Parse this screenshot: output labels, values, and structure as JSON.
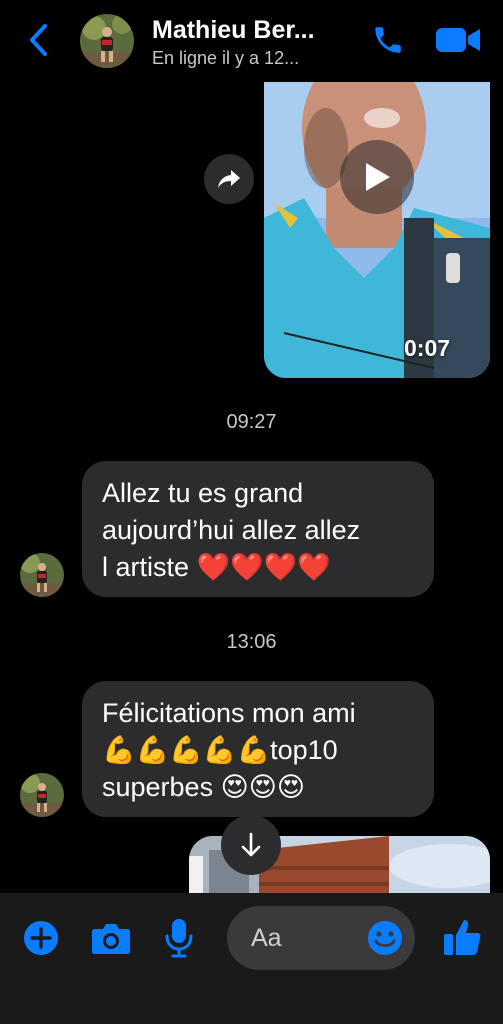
{
  "header": {
    "contact_name": "Mathieu Ber...",
    "status": "En ligne il y a 12...",
    "back_icon": "chevron-left-icon",
    "call_icon": "phone-icon",
    "video_call_icon": "video-camera-icon"
  },
  "video_message": {
    "duration": "0:07",
    "forward_icon": "share-arrow-icon",
    "play_icon": "play-icon"
  },
  "messages": [
    {
      "timestamp": "09:27",
      "lines": [
        "Allez tu es grand",
        "aujourd’hui allez allez",
        "l artiste ❤️❤️❤️❤️"
      ]
    },
    {
      "timestamp": "13:06",
      "lines": [
        "Félicitations mon ami",
        "💪💪💪💪💪top10",
        "superbes 😍😍😍"
      ]
    }
  ],
  "scroll_down_icon": "arrow-down-icon",
  "composer": {
    "placeholder": "Aa",
    "plus_icon": "plus-circle-icon",
    "camera_icon": "camera-icon",
    "mic_icon": "microphone-icon",
    "emoji_icon": "smiley-icon",
    "like_icon": "thumbs-up-icon"
  },
  "colors": {
    "background": "#000000",
    "bubble": "#2c2c2e",
    "accent": "#0a7cff",
    "composer_bar": "#1a1a1a",
    "input": "#3a3a3c",
    "secondary_text": "#c8c8cc"
  }
}
